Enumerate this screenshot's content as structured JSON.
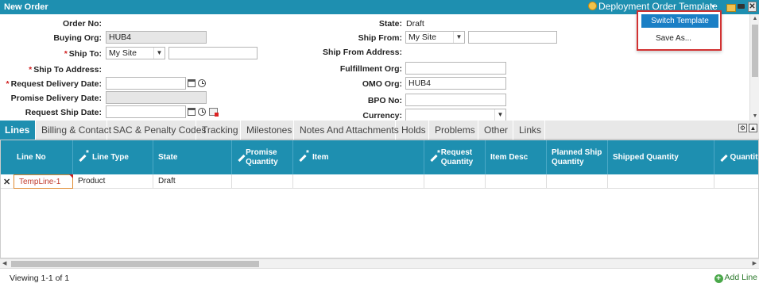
{
  "window": {
    "title": "New Order",
    "template_label": "Deployment Order Template",
    "caret": "▾",
    "close_glyph": "✕"
  },
  "template_menu": {
    "switch_label": "Switch Template",
    "save_as_label": "Save As..."
  },
  "form": {
    "order_no_label": "Order No:",
    "buying_org_label": "Buying Org:",
    "buying_org_value": "HUB4",
    "ship_to_label": "Ship To:",
    "ship_to_value": "My Site",
    "ship_to_address_label": "Ship To Address:",
    "request_delivery_date_label": "Request Delivery Date:",
    "promise_delivery_date_label": "Promise Delivery Date:",
    "request_ship_date_label": "Request Ship Date:",
    "state_label": "State:",
    "state_value": "Draft",
    "ship_from_label": "Ship From:",
    "ship_from_value": "My Site",
    "ship_from_address_label": "Ship From Address:",
    "fulfillment_org_label": "Fulfillment Org:",
    "omo_org_label": "OMO Org:",
    "omo_org_value": "HUB4",
    "bpo_no_label": "BPO No:",
    "currency_label": "Currency:",
    "required_mark": "*"
  },
  "tabs": [
    "Lines",
    "Billing & Contact",
    "SAC & Penalty Codes",
    "Tracking",
    "Milestones",
    "Notes And Attachments",
    "Holds",
    "Problems",
    "Other",
    "Links"
  ],
  "grid": {
    "columns": [
      "Line No",
      "Line Type",
      "State",
      "Promise Quantity",
      "Item",
      "Request Quantity",
      "Item Desc",
      "Planned Ship Quantity",
      "Shipped Quantity",
      "Quantity"
    ],
    "rows": [
      {
        "line_no": "TempLine-1",
        "line_type": "Product",
        "state": "Draft"
      }
    ]
  },
  "footer": {
    "viewing": "Viewing 1-1 of 1",
    "add_line": "Add Line"
  },
  "colors": {
    "header_blue": "#1e8fb0",
    "menu_blue": "#1a7fc5",
    "highlight_red": "#d23232"
  }
}
